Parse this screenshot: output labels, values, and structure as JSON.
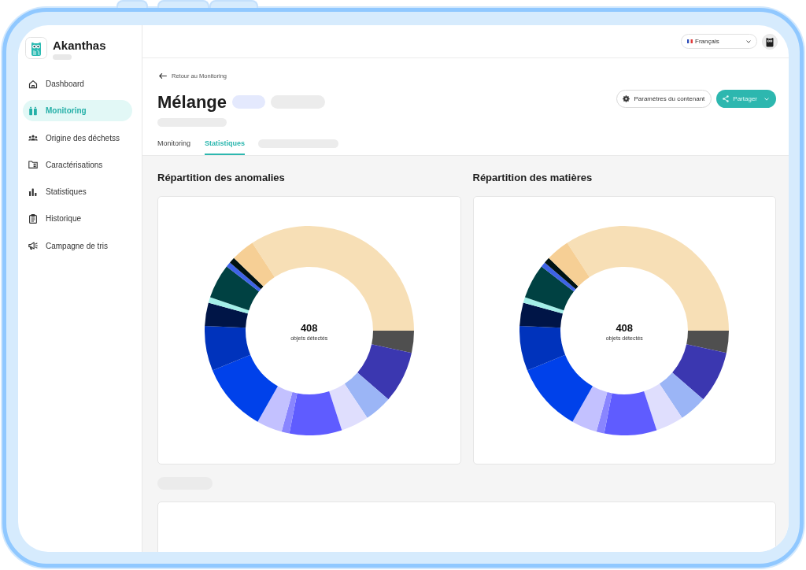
{
  "sidebar": {
    "brand": "Akanthas",
    "items": [
      {
        "label": "Dashboard",
        "selected": false
      },
      {
        "label": "Monitoring",
        "selected": true
      },
      {
        "label": "Origine des déchetss",
        "selected": false
      },
      {
        "label": "Caractérisations",
        "selected": false
      },
      {
        "label": "Statistiques",
        "selected": false
      },
      {
        "label": "Historique",
        "selected": false
      },
      {
        "label": "Campagne de tris",
        "selected": false
      }
    ]
  },
  "topbar": {
    "language": "Français"
  },
  "header": {
    "back_link": "Retour au Monitoring",
    "title": "Mélange",
    "buttons": [
      {
        "label": "Paramètres du contenant",
        "kind": "outline"
      },
      {
        "label": "Partager",
        "kind": "primary"
      }
    ],
    "tabs": [
      {
        "label": "Monitoring",
        "selected": false
      },
      {
        "label": "Statistiques",
        "selected": true
      }
    ]
  },
  "charts": [
    {
      "title": "Répartition des anomalies",
      "total": "408",
      "caption": "objets détectés"
    },
    {
      "title": "Répartition des matières",
      "total": "408",
      "caption": "objets détectés"
    }
  ]
}
